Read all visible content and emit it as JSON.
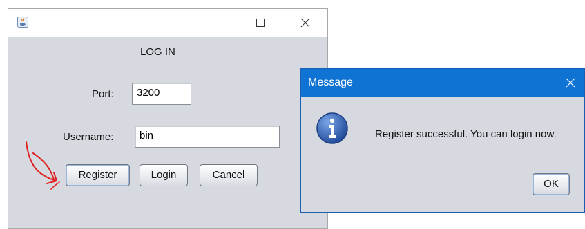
{
  "login_window": {
    "app_icon": "java-cup-icon",
    "heading": "LOG IN",
    "port_label": "Port:",
    "port_value": "3200",
    "username_label": "Username:",
    "username_value": "bin",
    "buttons": {
      "register": "Register",
      "login": "Login",
      "cancel": "Cancel"
    }
  },
  "message_dialog": {
    "title": "Message",
    "icon": "info-icon",
    "text": "Register successful. You can login now.",
    "ok_label": "OK"
  },
  "annotation": {
    "icon": "red-hand-drawn-arrow-icon",
    "color": "#e02020"
  },
  "colors": {
    "panel_bg": "#d6d9df",
    "dialog_title_bg": "#0f73d4",
    "info_icon_blue": "#2a5db0"
  }
}
